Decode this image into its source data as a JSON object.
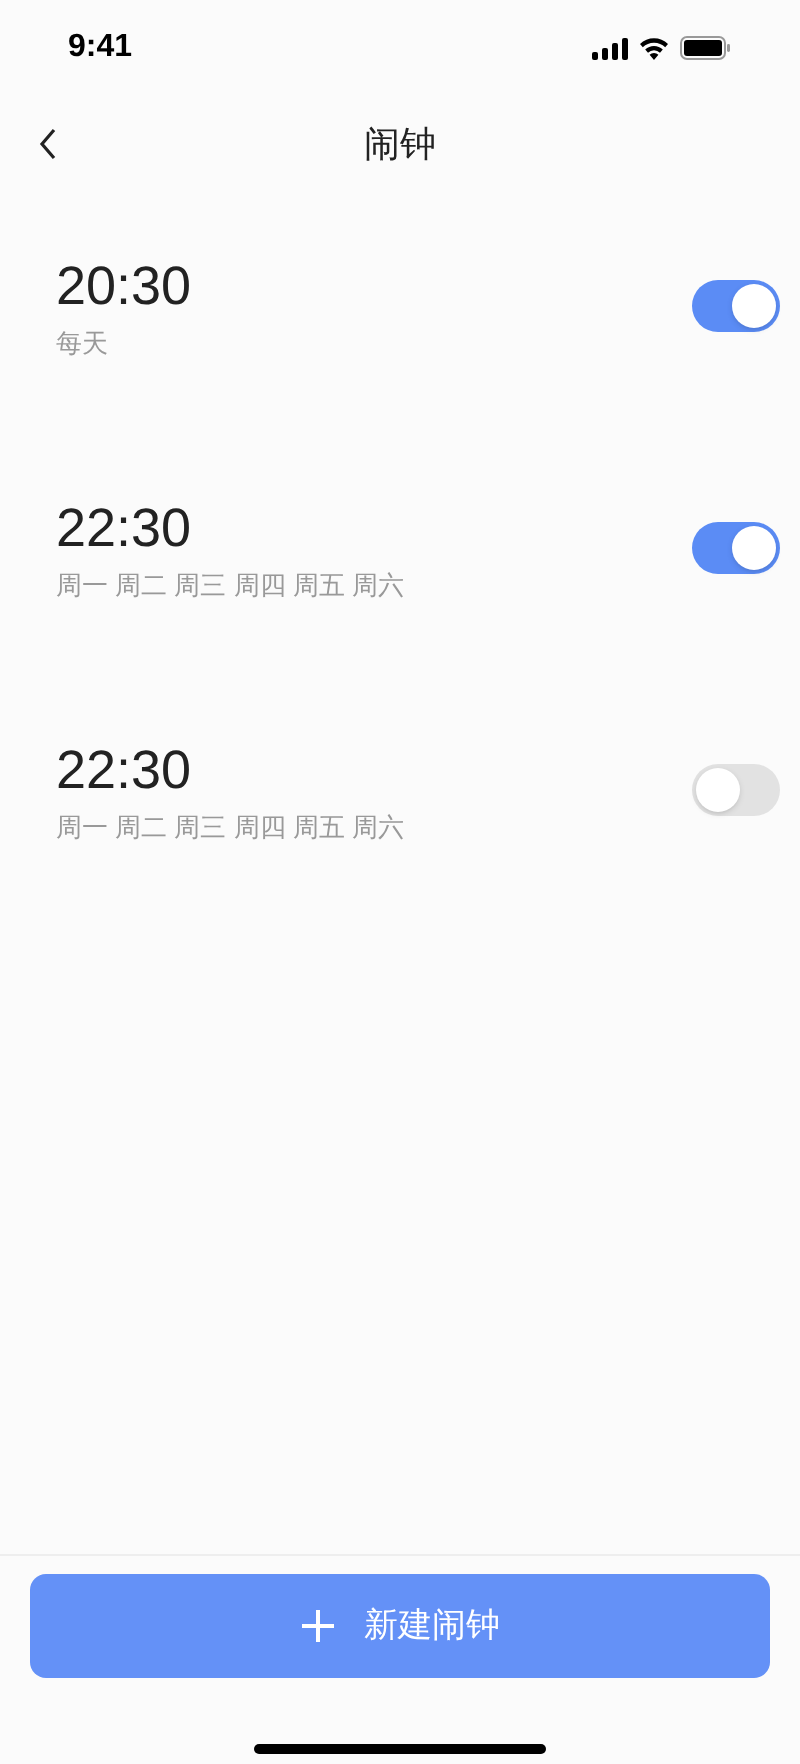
{
  "status_bar": {
    "time": "9:41"
  },
  "header": {
    "title": "闹钟"
  },
  "alarms": [
    {
      "time": "20:30",
      "repeat": "每天",
      "on": true
    },
    {
      "time": "22:30",
      "repeat": "周一 周二 周三 周四 周五 周六",
      "on": true
    },
    {
      "time": "22:30",
      "repeat": "周一 周二 周三 周四 周五 周六",
      "on": false
    }
  ],
  "add_button": {
    "label": "新建闹钟"
  }
}
